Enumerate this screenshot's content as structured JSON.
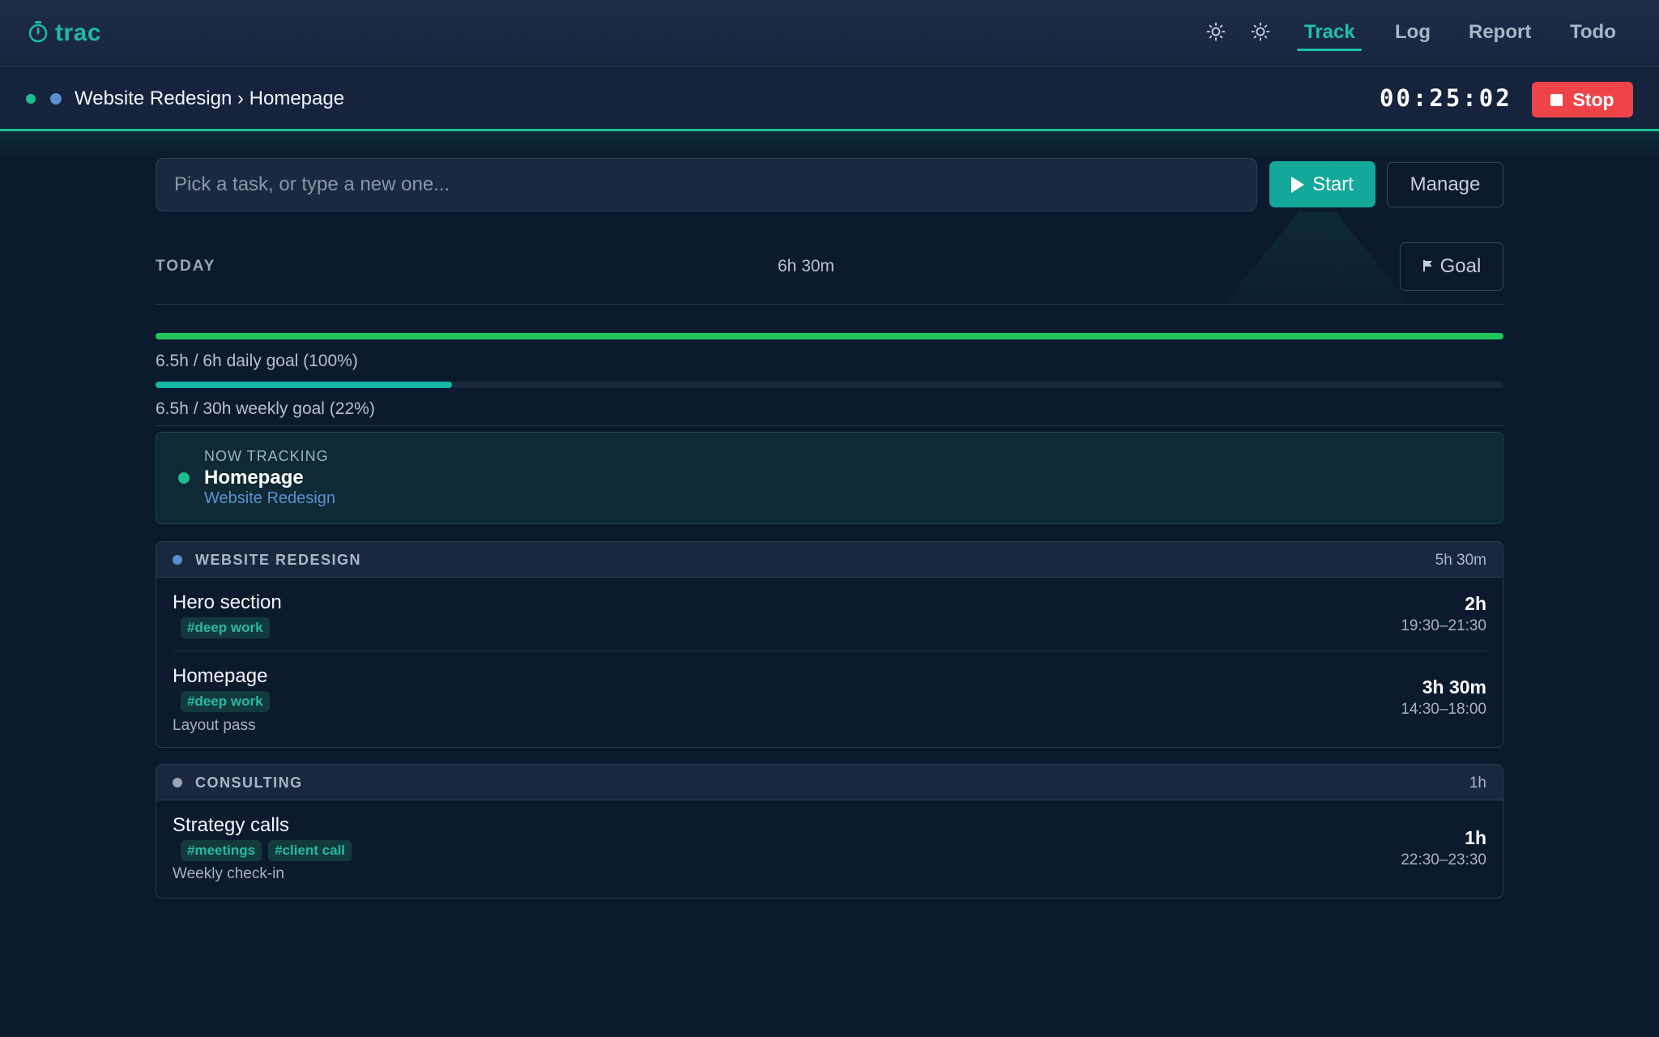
{
  "app": {
    "name": "trac"
  },
  "nav": {
    "items": [
      {
        "label": "Track",
        "active": true
      },
      {
        "label": "Log",
        "active": false
      },
      {
        "label": "Report",
        "active": false
      },
      {
        "label": "Todo",
        "active": false
      }
    ]
  },
  "tracker": {
    "breadcrumb": "Website Redesign › Homepage",
    "timer": "00:25:02",
    "stop_label": "Stop",
    "status_color": "#1cbf8e",
    "project_color": "#5b8ed0"
  },
  "task_entry": {
    "placeholder": "Pick a task, or type a new one...",
    "start_label": "Start",
    "manage_label": "Manage"
  },
  "today": {
    "label": "TODAY",
    "total": "6h 30m",
    "goal_label": "Goal"
  },
  "goals": {
    "daily": {
      "text": "6.5h / 6h daily goal (100%)",
      "progress": 1.0,
      "color": "#22c55e"
    },
    "weekly": {
      "text": "6.5h / 30h weekly goal (22%)",
      "progress": 0.22,
      "color": "#14b8a6"
    }
  },
  "now_tracking": {
    "label": "NOW TRACKING",
    "task": "Homepage",
    "project": "Website Redesign"
  },
  "groups": [
    {
      "name": "WEBSITE REDESIGN",
      "total": "5h 30m",
      "color": "#5b8ed0",
      "entries": [
        {
          "title": "Hero section",
          "tags": [
            "#deep work"
          ],
          "note": "",
          "duration": "2h",
          "range": "19:30–21:30"
        },
        {
          "title": "Homepage",
          "tags": [
            "#deep work"
          ],
          "note": "Layout pass",
          "duration": "3h 30m",
          "range": "14:30–18:00"
        }
      ]
    },
    {
      "name": "CONSULTING",
      "total": "1h",
      "color": "#9aa4b2",
      "entries": [
        {
          "title": "Strategy calls",
          "tags": [
            "#meetings",
            "#client call"
          ],
          "note": "Weekly check-in",
          "duration": "1h",
          "range": "22:30–23:30"
        }
      ]
    }
  ]
}
